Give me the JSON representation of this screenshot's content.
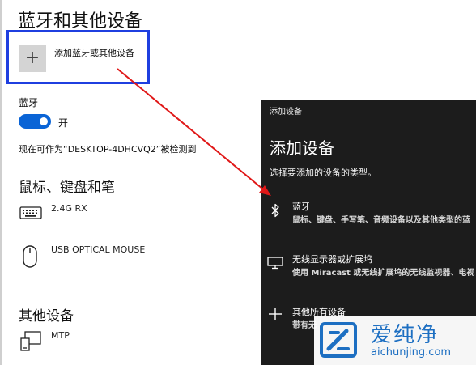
{
  "settings": {
    "title": "蓝牙和其他设备",
    "add_device": {
      "icon": "+",
      "label": "添加蓝牙或其他设备"
    },
    "bluetooth": {
      "label": "蓝牙",
      "state_label": "开",
      "on": true
    },
    "discoverable_text": "现在可作为“DESKTOP-4DHCVQ2”被检测到",
    "sections": {
      "mouse_keyboard_pen": {
        "title": "鼠标、键盘和笔",
        "devices": [
          {
            "name": "2.4G RX",
            "icon": "keyboard-icon"
          },
          {
            "name": "USB OPTICAL MOUSE",
            "icon": "mouse-icon"
          }
        ]
      },
      "other_devices": {
        "title": "其他设备",
        "devices": [
          {
            "name": "MTP",
            "icon": "device-icon"
          }
        ]
      }
    }
  },
  "dialog": {
    "window_title": "添加设备",
    "heading": "添加设备",
    "subtitle": "选择要添加的设备的类型。",
    "options": [
      {
        "icon": "bluetooth-icon",
        "title": "蓝牙",
        "description": "鼠标、键盘、手写笔、音频设备以及其他类型的蓝"
      },
      {
        "icon": "monitor-icon",
        "title": "无线显示器或扩展坞",
        "description": "使用 Miracast 或无线扩展坞的无线监视器、电视"
      },
      {
        "icon": "plus-icon",
        "title": "其他所有设备",
        "description": "带有无"
      }
    ]
  },
  "watermark": {
    "brand": "爱纯净",
    "site": "aichunjing.com"
  },
  "colors": {
    "accent": "#0a64d6",
    "highlight_box": "#1f3fe0",
    "arrow": "#e01818",
    "dialog_bg": "#1c1c1c",
    "watermark": "#1d6fc2"
  }
}
